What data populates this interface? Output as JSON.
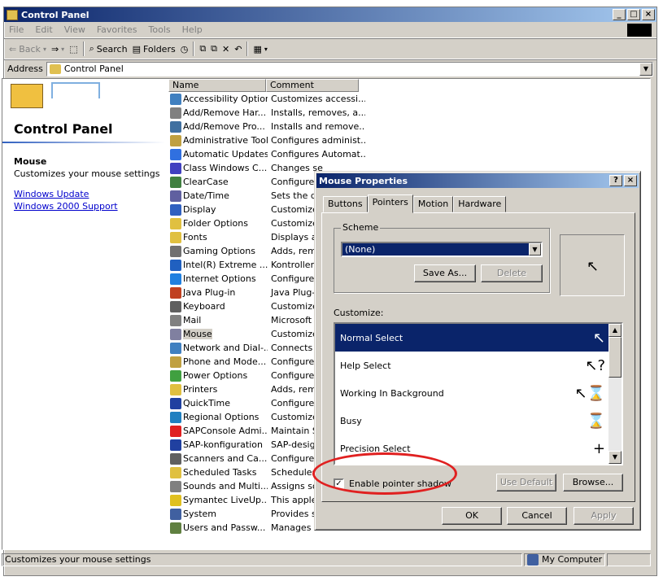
{
  "window": {
    "title": "Control Panel"
  },
  "menu": [
    "File",
    "Edit",
    "View",
    "Favorites",
    "Tools",
    "Help"
  ],
  "toolbar": {
    "back": "Back",
    "search": "Search",
    "folders": "Folders"
  },
  "address": {
    "label": "Address",
    "value": "Control Panel"
  },
  "left": {
    "title": "Control Panel",
    "selected_name": "Mouse",
    "selected_desc": "Customizes your mouse settings",
    "links": [
      "Windows Update",
      "Windows 2000 Support"
    ]
  },
  "columns": {
    "name": "Name",
    "comment": "Comment"
  },
  "items": [
    {
      "name": "Accessibility Options",
      "comment": "Customizes accessi...",
      "color": "#4080c0"
    },
    {
      "name": "Add/Remove Har...",
      "comment": "Installs, removes, a...",
      "color": "#808080"
    },
    {
      "name": "Add/Remove Pro...",
      "comment": "Installs and remove...",
      "color": "#4070a0"
    },
    {
      "name": "Administrative Tools",
      "comment": "Configures administ...",
      "color": "#c0a040"
    },
    {
      "name": "Automatic Updates",
      "comment": "Configures Automat...",
      "color": "#3070e0"
    },
    {
      "name": "Class Windows C...",
      "comment": "Changes se",
      "color": "#4040c0"
    },
    {
      "name": "ClearCase",
      "comment": "Configures",
      "color": "#408040"
    },
    {
      "name": "Date/Time",
      "comment": "Sets the da",
      "color": "#6060a0"
    },
    {
      "name": "Display",
      "comment": "Customizes",
      "color": "#3060c0"
    },
    {
      "name": "Folder Options",
      "comment": "Customizes",
      "color": "#e0c040"
    },
    {
      "name": "Fonts",
      "comment": "Displays an",
      "color": "#e0c040"
    },
    {
      "name": "Gaming Options",
      "comment": "Adds, remo",
      "color": "#707070"
    },
    {
      "name": "Intel(R) Extreme ...",
      "comment": "Kontrollera",
      "color": "#2060c0"
    },
    {
      "name": "Internet Options",
      "comment": "Configure y",
      "color": "#2080e0"
    },
    {
      "name": "Java Plug-in",
      "comment": "Java Plug-i",
      "color": "#c04020"
    },
    {
      "name": "Keyboard",
      "comment": "Customizes",
      "color": "#606060"
    },
    {
      "name": "Mail",
      "comment": "Microsoft C",
      "color": "#808080"
    },
    {
      "name": "Mouse",
      "comment": "Customizes",
      "color": "#8080a0",
      "selected": true
    },
    {
      "name": "Network and Dial-...",
      "comment": "Connects t",
      "color": "#4080c0"
    },
    {
      "name": "Phone and Mode...",
      "comment": "Configures",
      "color": "#c0a040"
    },
    {
      "name": "Power Options",
      "comment": "Configures",
      "color": "#40a040"
    },
    {
      "name": "Printers",
      "comment": "Adds, remo",
      "color": "#e0c040"
    },
    {
      "name": "QuickTime",
      "comment": "Configures",
      "color": "#2040a0"
    },
    {
      "name": "Regional Options",
      "comment": "Customizes",
      "color": "#2080c0"
    },
    {
      "name": "SAPConsole Admi...",
      "comment": "Maintain SA",
      "color": "#e02020"
    },
    {
      "name": "SAP-konfiguration",
      "comment": "SAP-design",
      "color": "#2040a0"
    },
    {
      "name": "Scanners and Ca...",
      "comment": "Configures",
      "color": "#606060"
    },
    {
      "name": "Scheduled Tasks",
      "comment": "Schedules",
      "color": "#e0c040"
    },
    {
      "name": "Sounds and Multi...",
      "comment": "Assigns sou",
      "color": "#808080"
    },
    {
      "name": "Symantec LiveUp...",
      "comment": "This applet",
      "color": "#e0c020"
    },
    {
      "name": "System",
      "comment": "Provides sy",
      "color": "#4060a0"
    },
    {
      "name": "Users and Passw...",
      "comment": "Manages users and ...",
      "color": "#608040"
    }
  ],
  "status": {
    "text": "Customizes your mouse settings",
    "zone": "My Computer"
  },
  "dialog": {
    "title": "Mouse Properties",
    "tabs": [
      "Buttons",
      "Pointers",
      "Motion",
      "Hardware"
    ],
    "scheme_label": "Scheme",
    "scheme_value": "(None)",
    "save_as": "Save As...",
    "delete": "Delete",
    "customize_label": "Customize:",
    "cursors": [
      {
        "name": "Normal Select",
        "glyph": "↖",
        "selected": true
      },
      {
        "name": "Help Select",
        "glyph": "↖?"
      },
      {
        "name": "Working In Background",
        "glyph": "↖⌛"
      },
      {
        "name": "Busy",
        "glyph": "⌛"
      },
      {
        "name": "Precision Select",
        "glyph": "+"
      }
    ],
    "shadow_label": "Enable pointer shadow",
    "shadow_checked": true,
    "use_default": "Use Default",
    "browse": "Browse...",
    "ok": "OK",
    "cancel": "Cancel",
    "apply": "Apply"
  }
}
